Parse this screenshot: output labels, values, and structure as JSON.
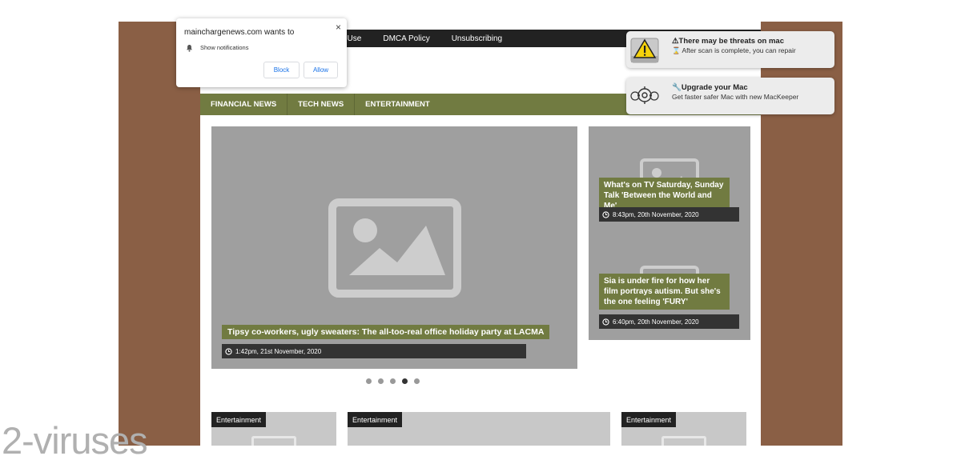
{
  "top_nav": {
    "items": [
      "f Use",
      "DMCA Policy",
      "Unsubscribing"
    ]
  },
  "main_nav": {
    "items": [
      "FINANCIAL NEWS",
      "TECH NEWS",
      "ENTERTAINMENT"
    ]
  },
  "hero": {
    "title": "Tipsy co-workers, ugly sweaters: The all-too-real office holiday party at LACMA",
    "date": "1:42pm, 21st November, 2020",
    "image_icon": "image-placeholder-icon"
  },
  "carousel": {
    "dot_count": 5,
    "active_index": 3
  },
  "side_posts": [
    {
      "title": "What's on TV Saturday, Sunday Talk 'Between the World and Me'",
      "date": "8:43pm, 20th November, 2020"
    },
    {
      "title": "Sia is under fire for how her film portrays autism. But she's the one feeling 'FURY'",
      "date": "6:40pm, 20th November, 2020"
    }
  ],
  "category_cards": [
    {
      "tag": "Entertainment"
    },
    {
      "tag": "Entertainment"
    },
    {
      "tag": "Entertainment"
    }
  ],
  "notification_popup": {
    "site": "mainchargenews.com wants to",
    "permission": "Show notifications",
    "block_label": "Block",
    "allow_label": "Allow",
    "close_glyph": "×"
  },
  "toasts": [
    {
      "icon": "warning-drive-icon",
      "title": "⚠There may be threats on mac",
      "body": "⌛ After scan is complete, you can repair"
    },
    {
      "icon": "gears-icon",
      "title": "🔧Upgrade your Mac",
      "body": "Get faster safer Mac with new MacKeeper"
    }
  ],
  "watermark": "2-viruses",
  "colors": {
    "frame": "#8a5f45",
    "accent": "#717b41",
    "dark": "#222222",
    "placeholder": "#9f9f9f"
  }
}
